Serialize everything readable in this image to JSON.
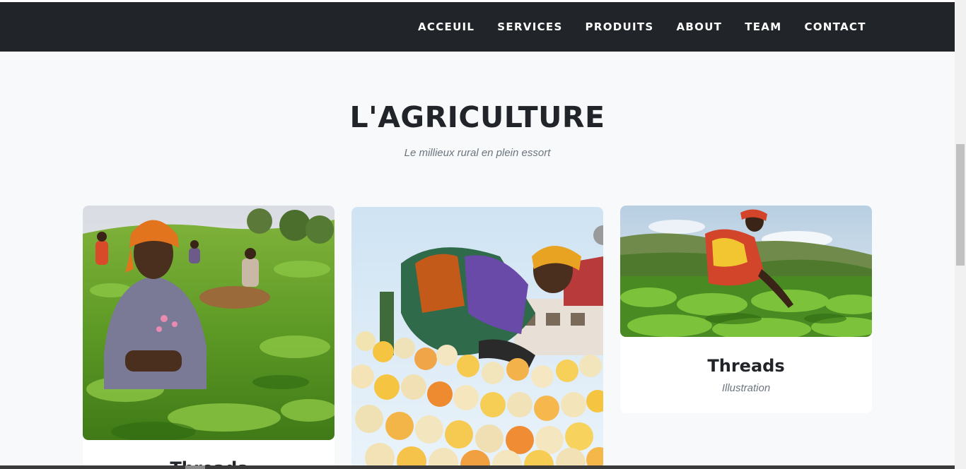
{
  "nav": {
    "items": [
      "ACCEUIL",
      "SERVICES",
      "PRODUITS",
      "ABOUT",
      "TEAM",
      "CONTACT"
    ]
  },
  "section": {
    "title": "L'AGRICULTURE",
    "subtitle": "Le millieux rural en plein essort"
  },
  "portfolio": [
    {
      "title": "Threads",
      "subtitle": ""
    },
    {
      "title": "",
      "subtitle": ""
    },
    {
      "title": "Threads",
      "subtitle": "Illustration"
    }
  ],
  "colors": {
    "navbar": "#212529",
    "background": "#f8f9fa",
    "heading": "#212529",
    "muted": "#6c757d"
  }
}
